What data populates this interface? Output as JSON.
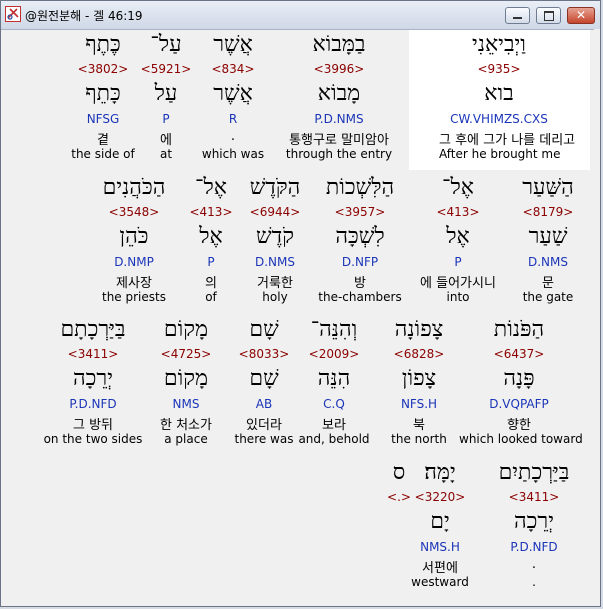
{
  "window": {
    "title": "@원전분해 - 겔 46:19"
  },
  "rows": [
    [
      {
        "heb": "וַיְבִיאֵנִי",
        "strong": "<935>",
        "heb2": "בוא",
        "morph": "CW.VHIMZS.CXS",
        "kor": "그 후에 그가 나를 데리고",
        "eng": "After he brought me"
      },
      {
        "heb": "בַמָּבוֹא",
        "strong": "<3996>",
        "heb2": "מָבוֹא",
        "morph": "P.D.NMS",
        "kor": "통행구로 말미암아",
        "eng": "through the entry"
      },
      {
        "heb": "אֲשֶׁר",
        "strong": "<834>",
        "heb2": "אֲשֶׁר",
        "morph": "R",
        "kor": ".",
        "eng": "which was"
      },
      {
        "heb": "עַל־",
        "strong": "<5921>",
        "heb2": "עַל",
        "morph": "P",
        "kor": "에",
        "eng": "at"
      },
      {
        "heb": "כֶּתֶף",
        "strong": "<3802>",
        "heb2": "כָּתֵף",
        "morph": "NFSG",
        "kor": "곁",
        "eng": "the side of"
      }
    ],
    [
      {
        "heb": "הַשַּׁעַר",
        "strong": "<8179>",
        "heb2": "שַׁעַר",
        "morph": "D.NMS",
        "kor": "문",
        "eng": "the gate"
      },
      {
        "heb": "אֶל־",
        "strong": "<413>",
        "heb2": "אֶל",
        "morph": "P",
        "kor": "에 들어가시니",
        "eng": "into"
      },
      {
        "heb": "הַלִּשְׁכוֹת",
        "strong": "<3957>",
        "heb2": "לִשְׁכָּה",
        "morph": "D.NFP",
        "kor": "방",
        "eng": "the-chambers"
      },
      {
        "heb": "הַקֹּדֶשׁ",
        "strong": "<6944>",
        "heb2": "קֹדֶשׁ",
        "morph": "D.NMS",
        "kor": "거룩한",
        "eng": "holy"
      },
      {
        "heb": "אֶל־",
        "strong": "<413>",
        "heb2": "אֶל",
        "morph": "P",
        "kor": "의",
        "eng": "of"
      },
      {
        "heb": "הַכֹּהֲנִים",
        "strong": "<3548>",
        "heb2": "כֹּהֵן",
        "morph": "D.NMP",
        "kor": "제사장",
        "eng": "the priests"
      }
    ],
    [
      {
        "heb": "הַפֹּנוֹת",
        "strong": "<6437>",
        "heb2": "פָּנָה",
        "morph": "D.VQPAFP",
        "kor": "향한",
        "eng": "which looked toward"
      },
      {
        "heb": "צָפוֹנָה",
        "strong": "<6828>",
        "heb2": "צָפוֹן",
        "morph": "NFS.H",
        "kor": "북",
        "eng": "the north"
      },
      {
        "heb": "וְהִנֵּה־",
        "strong": "<2009>",
        "heb2": "הִנֵּה",
        "morph": "C.Q",
        "kor": "보라",
        "eng": "and, behold"
      },
      {
        "heb": "שָׁם",
        "strong": "<8033>",
        "heb2": "שָׁם",
        "morph": "AB",
        "kor": "있더라",
        "eng": "there was"
      },
      {
        "heb": "מָקוֹם",
        "strong": "<4725>",
        "heb2": "מָקוֹם",
        "morph": "NMS",
        "kor": "한 처소가",
        "eng": "a place"
      },
      {
        "heb": "בַּיַּרְכָתָם",
        "strong": "<3411>",
        "heb2": "יְרֵכָה",
        "morph": "P.D.NFD",
        "kor": "그 방뒤",
        "eng": "on the two sides"
      }
    ],
    [
      {
        "heb": "בַּיַּרְכָתַיִם",
        "strong": "<3411>",
        "heb2": "יְרֵכָה",
        "morph": "P.D.NFD",
        "kor": ".",
        "eng": "."
      },
      {
        "heb": "יָמָּה׃",
        "strong": "<3220>",
        "heb2": "יָם",
        "morph": "NMS.H",
        "kor": "서편에",
        "eng": "westward"
      },
      {
        "heb": "ס",
        "strong": "<.>",
        "heb2": "",
        "morph": "",
        "kor": "",
        "eng": ""
      }
    ]
  ]
}
